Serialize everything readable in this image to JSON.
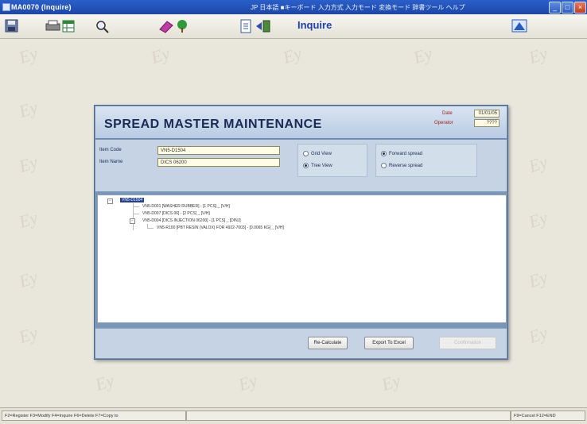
{
  "window": {
    "title": "MA0070 (Inquire)"
  },
  "ime_bar": {
    "text": "JP 日本語  ■キーボード  入力方式  入力モード  変換モード  辞書ツール  ヘルプ"
  },
  "toolbar": {
    "mode_label": "Inquire"
  },
  "dialog": {
    "title": "SPREAD MASTER MAINTENANCE",
    "date_label": "Date",
    "date_value": "01/01/05",
    "operator_label": "Operator",
    "operator_value": "????",
    "item_code_label": "Item Code",
    "item_code_value": "VN5-D1504",
    "item_name_label": "Item Name",
    "item_name_value": "DICS 06200",
    "view_options": [
      {
        "label": "Grid View",
        "selected": false
      },
      {
        "label": "Tree View",
        "selected": true
      }
    ],
    "spread_options": [
      {
        "label": "Forward spread",
        "selected": true
      },
      {
        "label": "Reverse spread",
        "selected": false
      }
    ],
    "tree": {
      "root": "VN5-D1504",
      "children": [
        "VN5-D001 [WASHER RUBBER] - [1 PCS] _ [V/H]",
        "VN5-D007 [DICS 06] - [2 PCS] _ [V/H]",
        "VN5-D004 [DICS INJECTION 06200] - [1 PCS] _ [DINJ]"
      ],
      "grandchildren": [
        "VN5-R100 [PBT RESIN (VALOX) FOR 4922-7003] - [0.0065 KG] _ [V/H]"
      ]
    },
    "buttons": {
      "recalculate": "Re-Calculate",
      "export": "Export To Excel",
      "third": "Confirmation"
    }
  },
  "status_bar": {
    "left": "F2=Register  F3=Modify  F4=Inquire  F6=Delete  F7=Copy to",
    "right": "F9=Cancel  F12=END"
  },
  "colors": {
    "accent": "#1f3fb5",
    "dialog_frame": "#7896b8",
    "selection": "#24409a"
  }
}
